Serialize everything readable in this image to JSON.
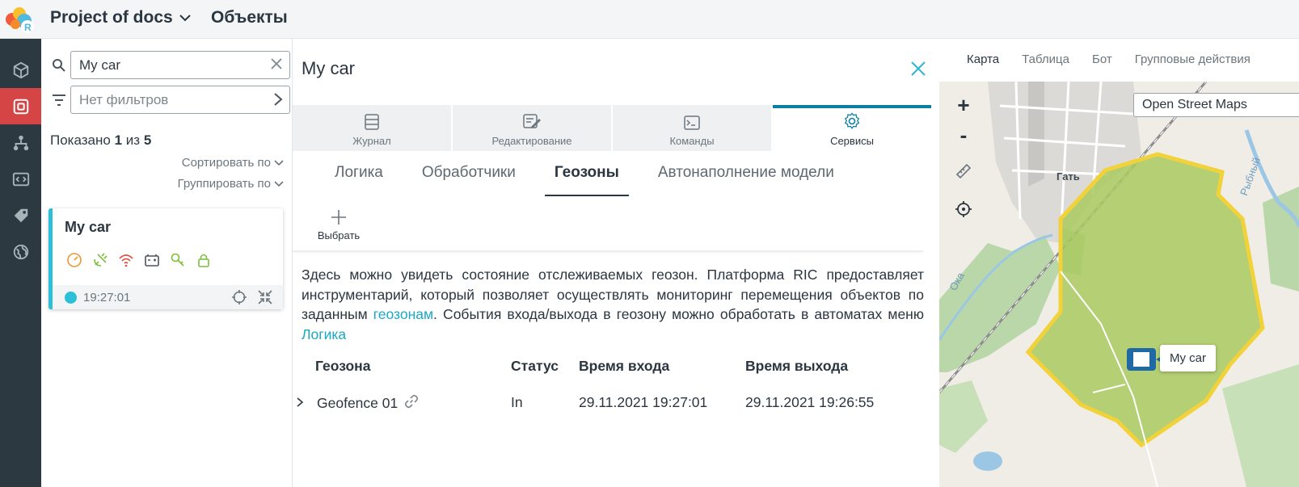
{
  "app": {
    "project_title": "Project of docs",
    "section_title": "Объекты"
  },
  "sidebar": {
    "items": [
      {
        "icon": "cube-icon"
      },
      {
        "icon": "objects-icon",
        "active": true
      },
      {
        "icon": "hierarchy-icon"
      },
      {
        "icon": "code-icon"
      },
      {
        "icon": "tag-icon"
      },
      {
        "icon": "globe-icon"
      }
    ]
  },
  "objects": {
    "search_value": "My car",
    "filter_placeholder": "Нет фильтров",
    "shown_prefix": "Показано",
    "shown_count": "1",
    "shown_of": "из",
    "shown_total": "5",
    "sort_label": "Сортировать по",
    "group_label": "Группировать по",
    "card": {
      "title": "My car",
      "time": "19:27:01",
      "status_color": "#2cc0d8"
    }
  },
  "details": {
    "title": "My car",
    "tabs": [
      {
        "label": "Журнал",
        "icon": "journal-icon"
      },
      {
        "label": "Редактирование",
        "icon": "edit-icon"
      },
      {
        "label": "Команды",
        "icon": "terminal-icon"
      },
      {
        "label": "Сервисы",
        "icon": "services-gear-icon",
        "active": true
      }
    ],
    "subtabs": [
      {
        "label": "Логика"
      },
      {
        "label": "Обработчики"
      },
      {
        "label": "Геозоны",
        "active": true
      },
      {
        "label": "Автонаполнение модели"
      }
    ],
    "pick_label": "Выбрать",
    "description": {
      "part1": "Здесь можно увидеть состояние отслеживаемых геозон. Платформа RIC предоставляет инструментарий, который позволяет осуществлять мониторинг перемещения объектов по заданным ",
      "link1": "геозонам",
      "part2": ". События входа/выхода в геозону можно обработать в автоматах меню ",
      "link2": "Логика"
    },
    "table": {
      "headers": [
        "Геозона",
        "Статус",
        "Время входа",
        "Время выхода"
      ],
      "rows": [
        {
          "name": "Geofence 01",
          "status": "In",
          "enter": "29.11.2021 19:27:01",
          "exit": "29.11.2021 19:26:55"
        }
      ]
    }
  },
  "map": {
    "tabs": [
      "Карта",
      "Таблица",
      "Бот",
      "Групповые действия"
    ],
    "zoom_in": "+",
    "zoom_out": "-",
    "layer": "Open Street Maps",
    "car_label": "My car",
    "places": [
      "Гать",
      "Ока",
      "Рыбный"
    ]
  },
  "colors": {
    "accent": "#2cc0d8",
    "active_rail": "#d64545",
    "link": "#1aa8c6",
    "tab_active_border": "#0d7ea3",
    "geofence_fill": "#a9c95f",
    "geofence_border": "#f2d23a"
  }
}
